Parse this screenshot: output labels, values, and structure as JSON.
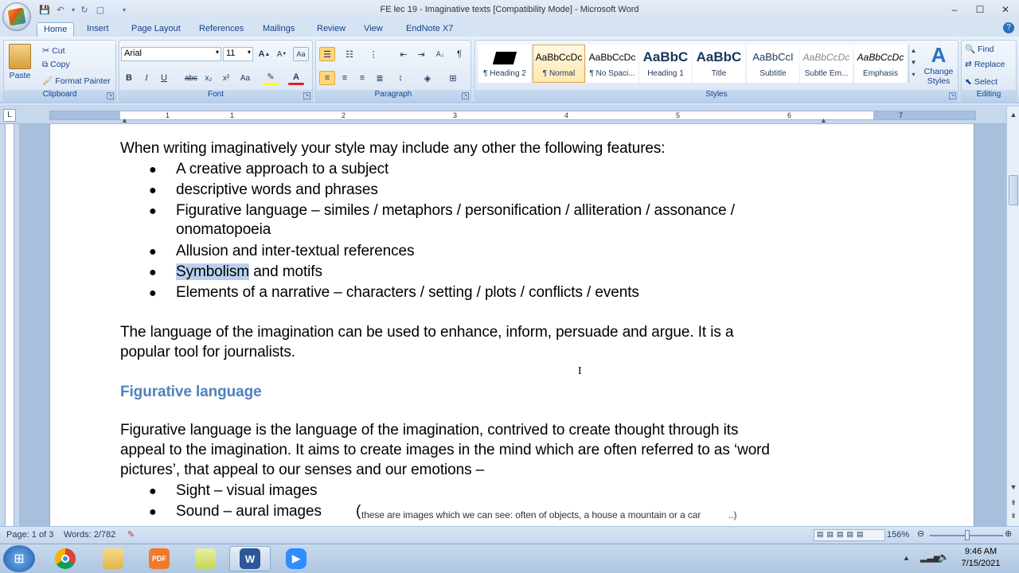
{
  "window": {
    "title": "FE lec 19 - Imaginative texts [Compatibility Mode] - Microsoft Word",
    "controls": [
      "–",
      "☐",
      "✕"
    ]
  },
  "tabs": [
    "Home",
    "Insert",
    "Page Layout",
    "References",
    "Mailings",
    "Review",
    "View",
    "EndNote X7"
  ],
  "active_tab": "Home",
  "ribbon": {
    "clipboard": {
      "label": "Clipboard",
      "paste": "Paste",
      "cut": "Cut",
      "copy": "Copy",
      "format_painter": "Format Painter"
    },
    "font": {
      "label": "Font",
      "name": "Arial",
      "size": "11"
    },
    "paragraph": {
      "label": "Paragraph"
    },
    "styles": {
      "label": "Styles",
      "items": [
        {
          "preview": "",
          "name": "¶ Heading 2"
        },
        {
          "preview": "AaBbCcDc",
          "name": "¶ Normal"
        },
        {
          "preview": "AaBbCcDc",
          "name": "¶ No Spaci..."
        },
        {
          "preview": "AaBbC",
          "name": "Heading 1"
        },
        {
          "preview": "AaBbC",
          "name": "Title"
        },
        {
          "preview": "AaBbCcI",
          "name": "Subtitle"
        },
        {
          "preview": "AaBbCcDc",
          "name": "Subtle Em..."
        },
        {
          "preview": "AaBbCcDc",
          "name": "Emphasis"
        }
      ],
      "change_styles": "Change Styles"
    },
    "editing": {
      "label": "Editing",
      "find": "Find",
      "replace": "Replace",
      "select": "Select"
    }
  },
  "ruler": {
    "marks": [
      "1",
      "1",
      "2",
      "3",
      "4",
      "5",
      "6",
      "7"
    ]
  },
  "document": {
    "intro": "When writing imaginatively your style may include any other the following features:",
    "bullets1": [
      "A creative approach to a subject",
      "descriptive words and phrases",
      "Figurative language – similes / metaphors / personification / alliteration / assonance /",
      "onomatopoeia",
      "Allusion and inter-textual references",
      "Symbolism",
      " and motifs",
      "Elements of a narrative – characters / setting / plots / conflicts / events"
    ],
    "para1_line1": "The language of the imagination can be used to enhance, inform, persuade and argue. It is a",
    "para1_line2": "popular tool for journalists.",
    "heading": "Figurative language",
    "para2_line1": "Figurative language is the language of the imagination, contrived to create thought through its",
    "para2_line2": "appeal to the imagination. It aims to create images in the mind which are often referred to as ‘word",
    "para2_line3": "pictures’, that appeal to our senses and our emotions –",
    "bullets2": [
      "Sight – visual images",
      "Sound – aural images"
    ],
    "annotation_paren": "(",
    "annotation": "these are images which we can see: often of objects, a house a mountain or a car",
    "annotation_end": "..)"
  },
  "status": {
    "page": "Page: 1 of 3",
    "words": "Words: 2/782",
    "zoom": "156%"
  },
  "clock": {
    "time": "9:46 AM",
    "date": "7/15/2021"
  }
}
